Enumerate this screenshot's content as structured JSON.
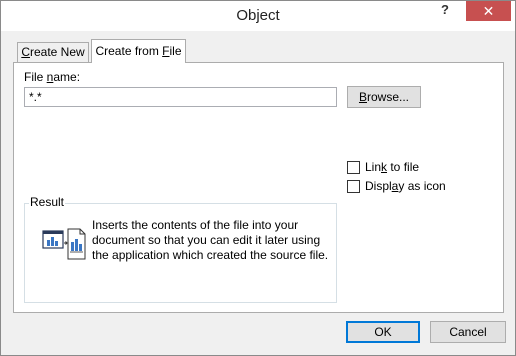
{
  "dialog": {
    "title": "Object",
    "help_glyph": "?",
    "close_glyph": "✕"
  },
  "tabs": [
    {
      "label_pre": "",
      "label_key": "C",
      "label_post": "reate New"
    },
    {
      "label_pre": "Create from ",
      "label_key": "F",
      "label_post": "ile"
    }
  ],
  "file": {
    "label_pre": "File ",
    "label_key": "n",
    "label_post": "ame:",
    "value": "*.*",
    "browse_pre": "",
    "browse_key": "B",
    "browse_post": "rowse..."
  },
  "options": {
    "link_pre": "Lin",
    "link_key": "k",
    "link_post": " to file",
    "display_pre": "Displ",
    "display_key": "a",
    "display_post": "y as icon"
  },
  "result": {
    "legend": "Result",
    "text": "Inserts the contents of the file into your document so that you can edit it later using the application which created the source file."
  },
  "buttons": {
    "ok": "OK",
    "cancel": "Cancel"
  }
}
